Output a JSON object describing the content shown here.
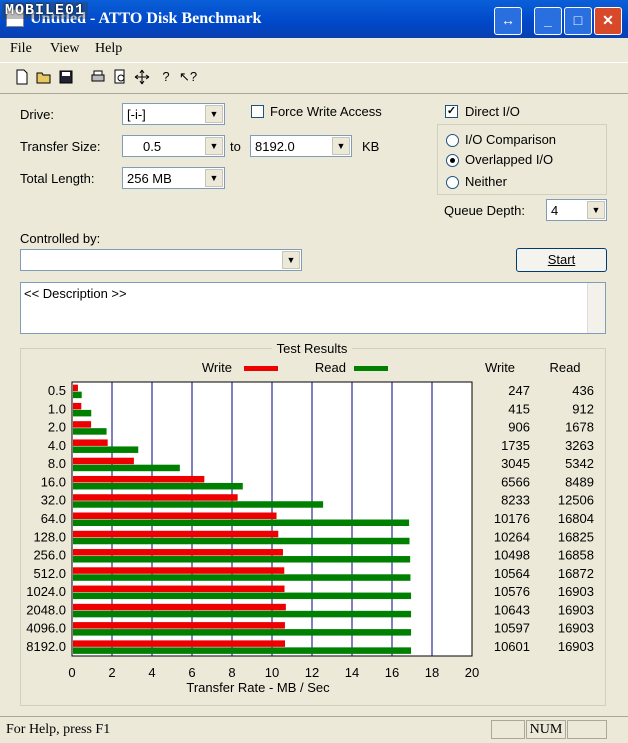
{
  "window": {
    "title": "Untitled - ATTO Disk Benchmark",
    "watermark": "MOBILE01"
  },
  "menu": {
    "file": "File",
    "view": "View",
    "help": "Help"
  },
  "toolbar": {
    "icons": [
      "new-icon",
      "open-icon",
      "save-icon",
      "print-icon",
      "print-preview-icon",
      "move-icon",
      "help-icon",
      "context-help-icon"
    ]
  },
  "settings": {
    "drive_label": "Drive:",
    "drive_value": "[-i-]",
    "transfer_label": "Transfer Size:",
    "transfer_from": "0.5",
    "to_label": "to",
    "transfer_to": "8192.0",
    "kb_label": "KB",
    "length_label": "Total Length:",
    "length_value": "256 MB",
    "force_write_label": "Force Write Access",
    "force_write_checked": false,
    "direct_io_label": "Direct I/O",
    "direct_io_checked": true,
    "io_comparison_label": "I/O Comparison",
    "overlapped_label": "Overlapped I/O",
    "neither_label": "Neither",
    "selected_mode": "overlapped",
    "queue_label": "Queue Depth:",
    "queue_value": "4",
    "controlled_label": "Controlled by:",
    "controlled_value": "",
    "start_label": "Start",
    "description": "<< Description >>"
  },
  "results_title": "Test Results",
  "legend": {
    "write": "Write",
    "read": "Read"
  },
  "table_headers": {
    "write": "Write",
    "read": "Read"
  },
  "colors": {
    "write": "#ee0000",
    "read": "#008000",
    "grid": "#000080"
  },
  "chart_data": {
    "type": "bar",
    "orientation": "horizontal",
    "categories": [
      "0.5",
      "1.0",
      "2.0",
      "4.0",
      "8.0",
      "16.0",
      "32.0",
      "64.0",
      "128.0",
      "256.0",
      "512.0",
      "1024.0",
      "2048.0",
      "4096.0",
      "8192.0"
    ],
    "series": [
      {
        "name": "Write",
        "values": [
          247,
          415,
          906,
          1735,
          3045,
          6566,
          8233,
          10176,
          10264,
          10498,
          10564,
          10576,
          10643,
          10597,
          10601
        ]
      },
      {
        "name": "Read",
        "values": [
          436,
          912,
          1678,
          3263,
          5342,
          8489,
          12506,
          16804,
          16825,
          16858,
          16872,
          16903,
          16903,
          16903,
          16903
        ]
      }
    ],
    "xlabel": "Transfer Rate - MB / Sec",
    "xlim": [
      0,
      20
    ],
    "xticks": [
      "0",
      "2",
      "4",
      "6",
      "8",
      "10",
      "12",
      "14",
      "16",
      "18",
      "20"
    ],
    "table_write": [
      "247",
      "415",
      "906",
      "1735",
      "3045",
      "6566",
      "8233",
      "10176",
      "10264",
      "10498",
      "10564",
      "10576",
      "10643",
      "10597",
      "10601"
    ],
    "table_read": [
      "436",
      "912",
      "1678",
      "3263",
      "5342",
      "8489",
      "12506",
      "16804",
      "16825",
      "16858",
      "16872",
      "16903",
      "16903",
      "16903",
      "16903"
    ]
  },
  "status": {
    "help": "For Help, press F1",
    "num": "NUM"
  }
}
